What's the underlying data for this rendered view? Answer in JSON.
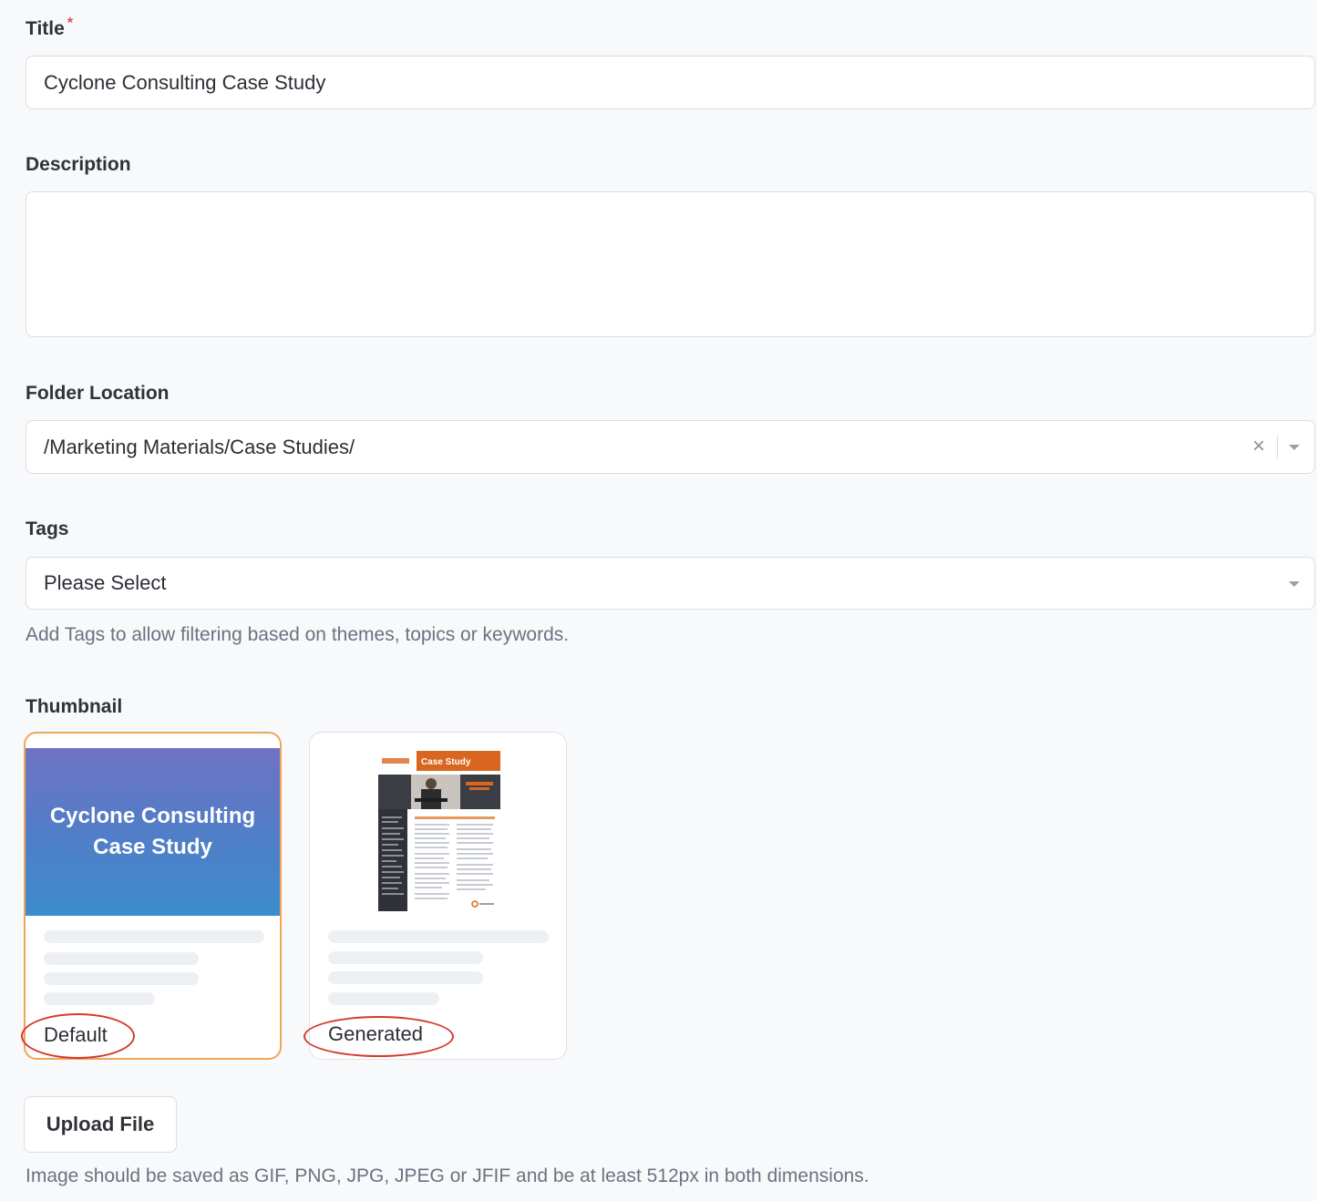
{
  "title_field": {
    "label": "Title",
    "required_mark": "*",
    "value": "Cyclone Consulting Case Study"
  },
  "description_field": {
    "label": "Description",
    "value": ""
  },
  "folder_field": {
    "label": "Folder Location",
    "value": "/Marketing Materials/Case Studies/",
    "clear_glyph": "×"
  },
  "tags_field": {
    "label": "Tags",
    "placeholder": "Please Select",
    "help": "Add Tags to allow filtering based on themes, topics or keywords."
  },
  "thumbnail": {
    "label": "Thumbnail",
    "options": [
      {
        "label": "Default",
        "selected": true,
        "banner_lines": [
          "Cyclone Consulting",
          "Case Study"
        ]
      },
      {
        "label": "Generated",
        "selected": false,
        "doc_header": "Case Study"
      }
    ],
    "upload_label": "Upload File",
    "help": "Image should be saved as GIF, PNG, JPG, JPEG or JFIF and be at least 512px in both dimensions."
  },
  "colors": {
    "selected_border": "#f0a55c",
    "annotation_ring": "#d33a2c",
    "required_mark": "#e5484d",
    "banner_top": "#6f72c4",
    "banner_bottom": "#3d8ccb",
    "doc_orange": "#d9661f",
    "doc_sidebar": "#2f3238"
  }
}
